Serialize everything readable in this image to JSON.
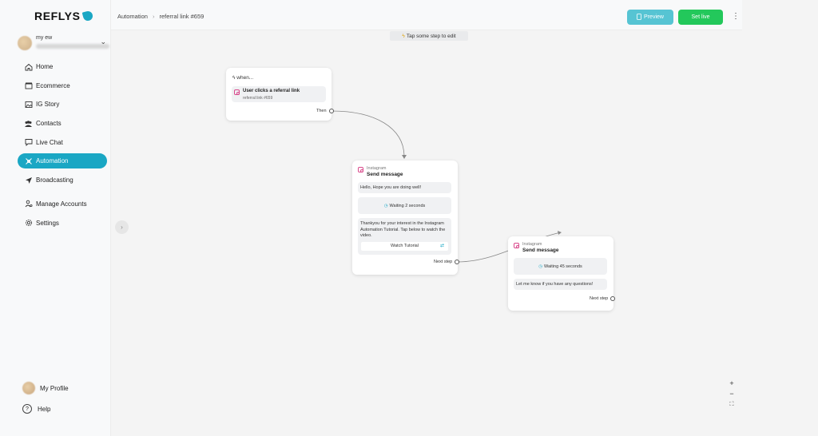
{
  "brand": {
    "name": "REFLYS",
    "accent": "#1aa7c4"
  },
  "account": {
    "name": "my ew"
  },
  "nav": [
    {
      "label": "Home",
      "icon": "home-icon",
      "active": false
    },
    {
      "label": "Ecommerce",
      "icon": "store-icon",
      "active": false
    },
    {
      "label": "IG Story",
      "icon": "image-icon",
      "active": false
    },
    {
      "label": "Contacts",
      "icon": "users-icon",
      "active": false
    },
    {
      "label": "Live Chat",
      "icon": "chat-icon",
      "active": false
    },
    {
      "label": "Automation",
      "icon": "automation-icon",
      "active": true
    },
    {
      "label": "Broadcasting",
      "icon": "send-icon",
      "active": false
    },
    {
      "label": "Manage Accounts",
      "icon": "user-gear-icon",
      "active": false
    },
    {
      "label": "Settings",
      "icon": "gear-icon",
      "active": false
    }
  ],
  "bottom_nav": {
    "profile": "My Profile",
    "help": "Help"
  },
  "breadcrumb": {
    "root": "Automation",
    "current": "referral link #659"
  },
  "toolbar": {
    "preview": "Preview",
    "set_live": "Set live"
  },
  "hint": "Tap some step to edit",
  "trigger": {
    "header": "when...",
    "title": "User clicks a referral link",
    "subtitle": "referral link #659",
    "port_label": "Then"
  },
  "step1": {
    "platform": "Instagram",
    "title": "Send message",
    "message1": "Hello, Hope you are doing well!",
    "wait": "Waiting 2 seconds",
    "message2": "Thankyou for your interest in the Instagram Automation Tutorial. Tap below to watch the video.",
    "button": "Watch Tutorial",
    "port_label": "Next step"
  },
  "step2": {
    "platform": "Instagram",
    "title": "Send message",
    "wait": "Waiting 45 seconds",
    "message": "Let me know if you have any questions!",
    "port_label": "Next step"
  },
  "zoom": {
    "in": "+",
    "out": "−",
    "fit": "⛶"
  }
}
